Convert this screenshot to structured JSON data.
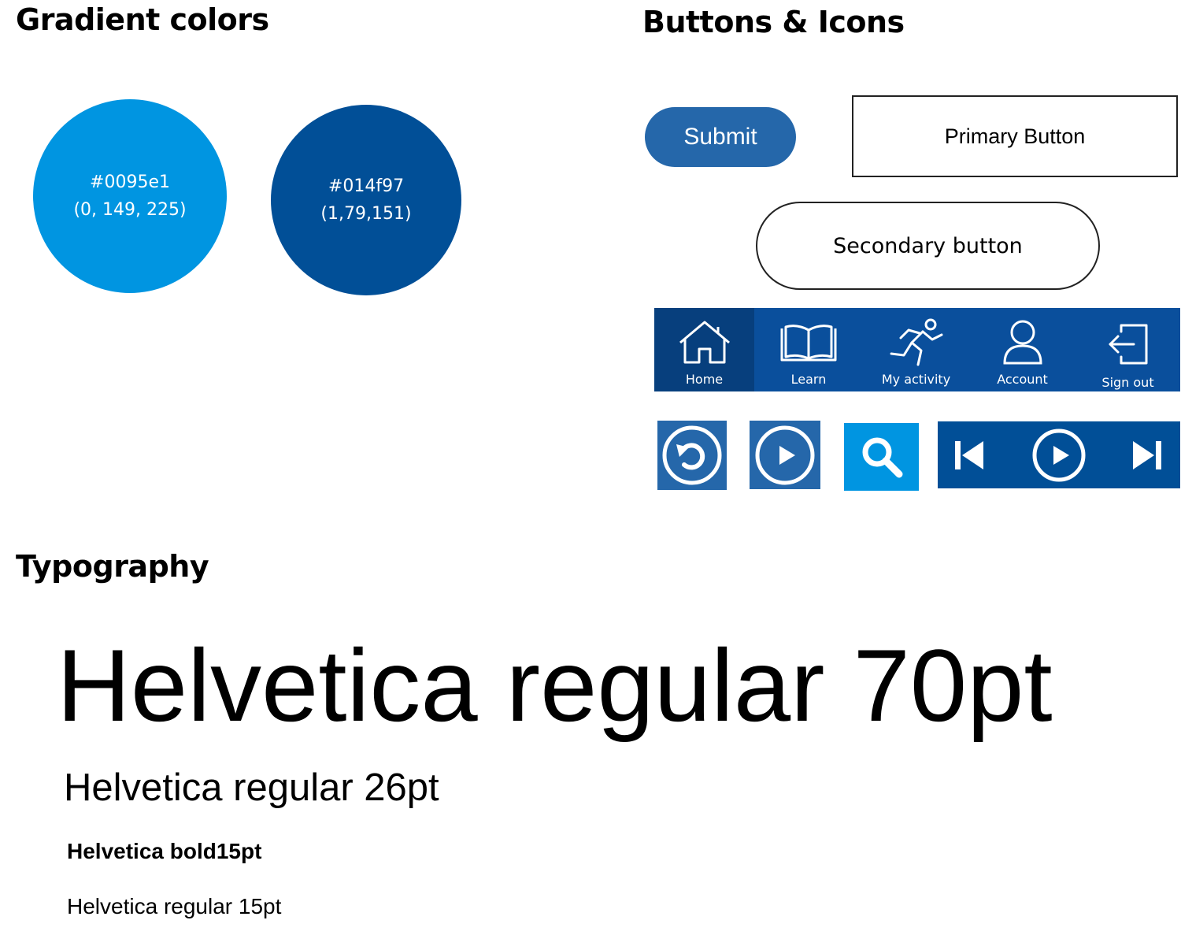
{
  "headings": {
    "gradient": "Gradient colors",
    "buttons": "Buttons & Icons",
    "typography": "Typography"
  },
  "colors": {
    "light": {
      "hex": "#0095e1",
      "rgb": "(0, 149, 225)",
      "fill": "#0095e1"
    },
    "dark": {
      "hex": "#014f97",
      "rgb": "(1,79,151)",
      "fill": "#014f97"
    }
  },
  "buttons": {
    "submit": "Submit",
    "primary": "Primary Button",
    "secondary": "Secondary button",
    "submit_color": "#2567aa"
  },
  "nav": {
    "bar_color": "#0a4f9c",
    "active_color": "#073f7d",
    "items": [
      {
        "label": "Home",
        "icon": "home-icon",
        "active": true
      },
      {
        "label": "Learn",
        "icon": "book-icon",
        "active": false
      },
      {
        "label": "My activity",
        "icon": "running-person-icon",
        "active": false
      },
      {
        "label": "Account",
        "icon": "user-icon",
        "active": false
      },
      {
        "label": "Sign out",
        "icon": "sign-out-icon",
        "active": false
      }
    ]
  },
  "icon_buttons": [
    {
      "icon": "replay-icon",
      "color": "#2567aa"
    },
    {
      "icon": "play-icon",
      "color": "#2567aa"
    },
    {
      "icon": "search-icon",
      "color": "#0095e1"
    }
  ],
  "media_controls": {
    "color": "#014f97",
    "icons": [
      "skip-back-icon",
      "play-circle-icon",
      "skip-forward-icon"
    ]
  },
  "typography": {
    "size70": "Helvetica regular 70pt",
    "size26": "Helvetica regular 26pt",
    "bold15": "Helvetica bold15pt",
    "regular15": "Helvetica regular 15pt"
  }
}
